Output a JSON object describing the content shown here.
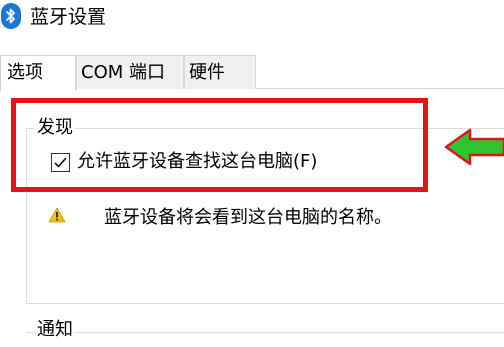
{
  "window": {
    "title": "蓝牙设置",
    "icon": "bluetooth-icon"
  },
  "tabs": [
    {
      "label": "选项",
      "active": true
    },
    {
      "label": "COM 端口",
      "active": false
    },
    {
      "label": "硬件",
      "active": false
    }
  ],
  "discovery": {
    "group_title": "发现",
    "allow_discovery_label": "允许蓝牙设备查找这台电脑(F)",
    "allow_discovery_checked": true,
    "warning_icon": "warning-icon",
    "warning_text": "蓝牙设备将会看到这台电脑的名称。"
  },
  "notifications": {
    "group_title": "通知"
  },
  "annotation": {
    "highlight_color": "#e1141b",
    "arrow_color": "#2fc42f",
    "arrow_outline": "#e1141b"
  },
  "colors": {
    "bluetooth_blue": "#1d75d6",
    "warning_yellow": "#f2c200"
  }
}
